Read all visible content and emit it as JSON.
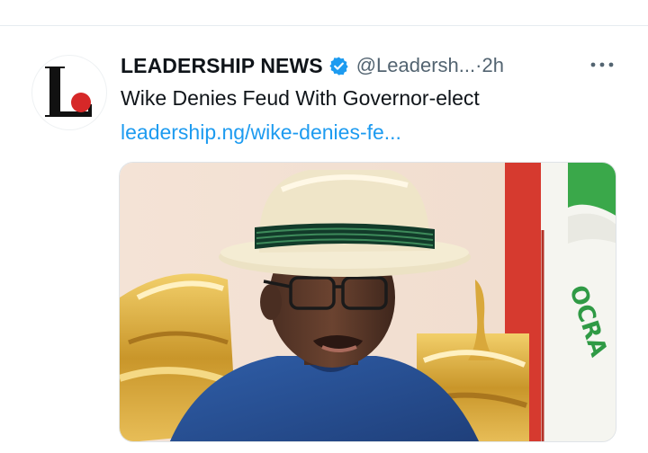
{
  "tweet": {
    "author_name": "LEADERSHIP NEWS",
    "handle": "@Leadersh...",
    "time_separator": " · ",
    "time": "2h",
    "text": "Wike Denies Feud With Governor-elect",
    "link": "leadership.ng/wike-denies-fe...",
    "verified": true,
    "icons": {
      "avatar": "leadership-logo",
      "verified": "verified-badge-icon",
      "more": "more-options-icon"
    },
    "colors": {
      "name": "#0f1419",
      "secondary": "#536471",
      "link": "#1d9bf0",
      "verified": "#1d9bf0",
      "logo_dot": "#d62828"
    }
  }
}
